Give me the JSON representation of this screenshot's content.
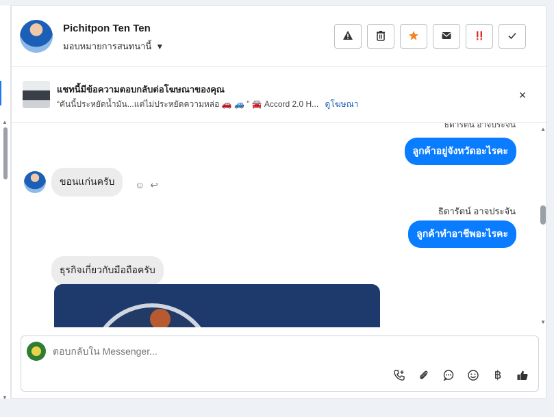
{
  "header": {
    "name": "Pichitpon Ten Ten",
    "assign_label": "มอบหมายการสนทนานี้",
    "actions": [
      {
        "name": "report-button",
        "icon": "warning-icon",
        "glyph": "⚠"
      },
      {
        "name": "delete-button",
        "icon": "trash-icon",
        "glyph": "🗑"
      },
      {
        "name": "star-button",
        "icon": "star-icon",
        "glyph": "★",
        "color": "#f5821f"
      },
      {
        "name": "mark-unread-button",
        "icon": "envelope-icon",
        "glyph": "✉"
      },
      {
        "name": "spam-button",
        "icon": "exclamation-icon",
        "glyph": "‼",
        "color": "#d93025"
      },
      {
        "name": "done-button",
        "icon": "check-icon",
        "glyph": "✓"
      }
    ]
  },
  "ad": {
    "title": "แชทนี้มีข้อความตอบกลับต่อโฆษณาของคุณ",
    "subtitle": "“คันนี้ประหยัดน้ำมัน...แต่ไม่ประหยัดความหล่อ 🚗 🚙 ” 🚘 Accord 2.0 H...",
    "link": "ดูโฆษณา",
    "close": "×"
  },
  "chat": {
    "sender_top": "ธิดารัตน์ อาจประจัน",
    "messages": [
      {
        "dir": "out",
        "text": "ลูกค้าอยู่จังหวัดอะไรคะ"
      },
      {
        "dir": "in",
        "text": "ขอนแก่นครับ"
      },
      {
        "dir": "out",
        "sender": "ธิดารัตน์ อาจประจัน",
        "text": "ลูกค้าทำอาชีพอะไรคะ"
      },
      {
        "dir": "in",
        "text": "ธุรกิจเกี่ยวกับมือถือครับ"
      }
    ],
    "reactions": [
      "☺",
      "↩"
    ]
  },
  "composer": {
    "placeholder": "ตอบกลับใน Messenger...",
    "tools": [
      {
        "name": "call-icon",
        "glyph": "✆"
      },
      {
        "name": "attach-icon",
        "glyph": "📎"
      },
      {
        "name": "saved-reply-icon",
        "glyph": "💬"
      },
      {
        "name": "emoji-icon",
        "glyph": "☺"
      },
      {
        "name": "baht-icon",
        "glyph": "฿"
      },
      {
        "name": "thumbs-up-icon",
        "glyph": "👍"
      }
    ]
  }
}
